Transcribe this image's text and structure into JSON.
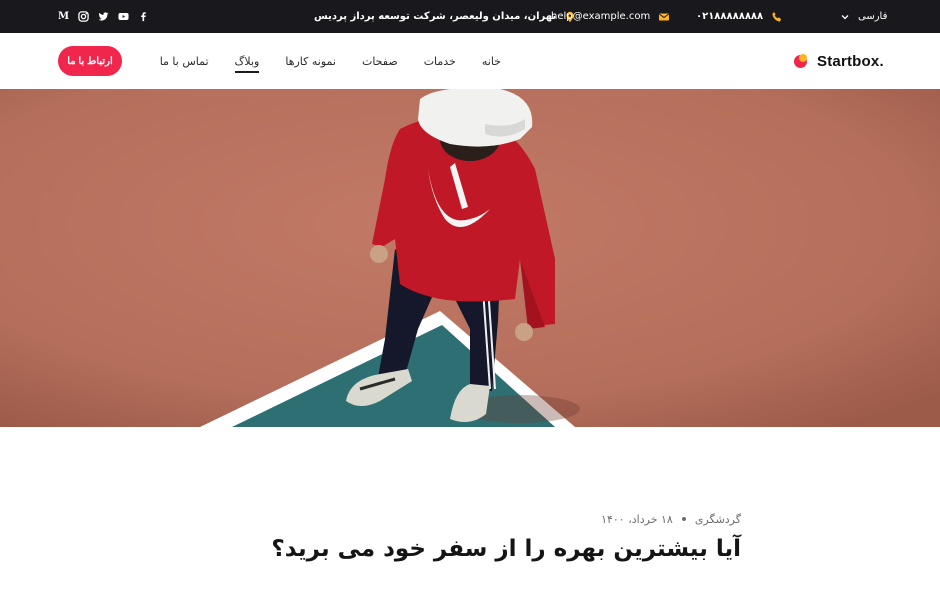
{
  "topbar": {
    "language": "فارسی",
    "phone": "۰۲۱۸۸۸۸۸۸۸۸",
    "email": "help@example.com",
    "address": "تهران، میدان ولیعصر، شرکت توسعه پرداز پردیس",
    "social": [
      "medium-icon",
      "instagram-icon",
      "twitter-icon",
      "youtube-icon",
      "facebook-icon"
    ],
    "icon_color": "#ffb321",
    "background": "#19191d"
  },
  "header": {
    "logo_text": "Startbox.",
    "nav": [
      "خانه",
      "خدمات",
      "صفحات",
      "نمونه کارها",
      "وبلاگ",
      "تماس با ما"
    ],
    "active_nav": "وبلاگ",
    "cta_label": "ارتباط با ما",
    "accent": "#f0264d"
  },
  "post": {
    "category": "گردشگری",
    "date": "۱۸ خرداد، ۱۴۰۰",
    "title": "آیا بیشترین بهره را از سفر خود می برید؟"
  }
}
